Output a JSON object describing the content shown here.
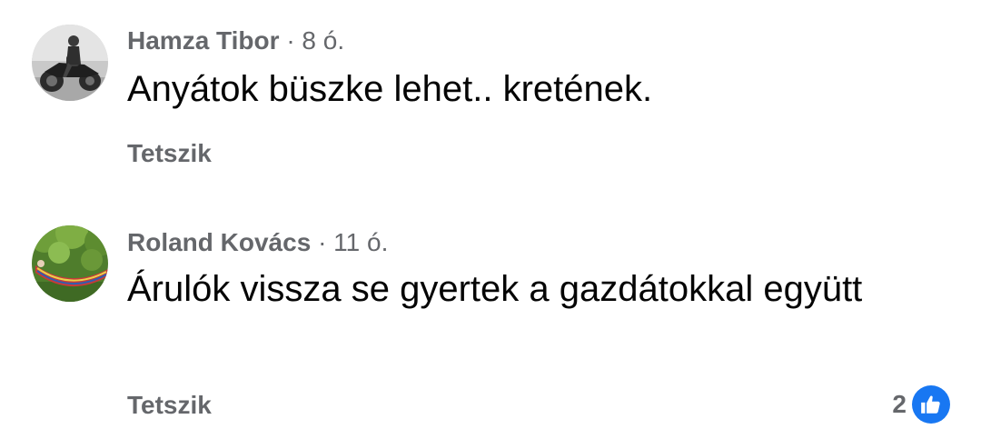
{
  "comments": [
    {
      "author": "Hamza Tibor",
      "separator": "·",
      "time": "8 ó.",
      "text": "Anyátok büszke lehet.. kretének.",
      "like_label": "Tetszik",
      "avatar_icon": "motorcycle-rider-photo"
    },
    {
      "author": "Roland Kovács",
      "separator": "·",
      "time": "11 ó.",
      "text": "Árulók vissza se gyertek a gazdátokkal együtt",
      "like_label": "Tetszik",
      "avatar_icon": "hammock-in-garden-photo",
      "reaction_count": "2",
      "reaction_icon": "thumbs-up-icon"
    }
  ],
  "colors": {
    "meta_gray": "#65676b",
    "text_black": "#050505",
    "like_blue": "#1877f2"
  }
}
